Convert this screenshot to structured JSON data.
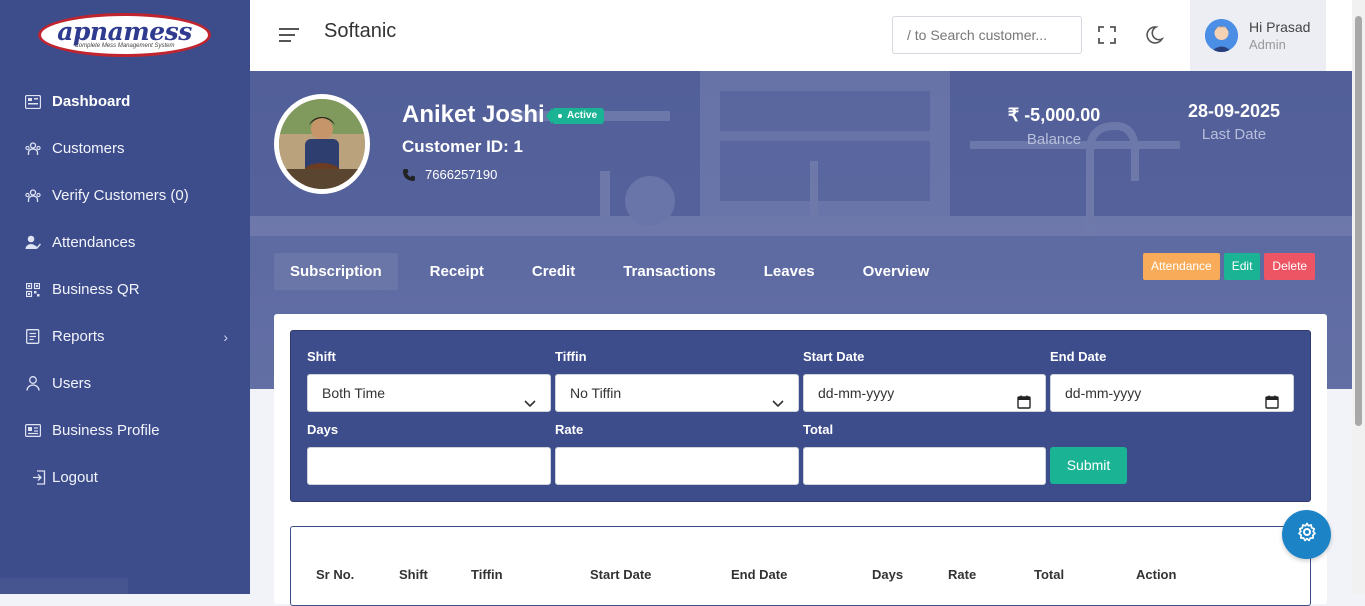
{
  "logo": {
    "title": "apnamess",
    "subtitle": "Complete Mess Management System"
  },
  "sidebar": {
    "items": [
      {
        "label": "Dashboard"
      },
      {
        "label": "Customers"
      },
      {
        "label": "Verify Customers (0)"
      },
      {
        "label": "Attendances"
      },
      {
        "label": "Business QR"
      },
      {
        "label": "Reports"
      },
      {
        "label": "Users"
      },
      {
        "label": "Business Profile"
      },
      {
        "label": "Logout"
      }
    ]
  },
  "header": {
    "brand": "Softanic",
    "search_placeholder": "/ to Search customer...",
    "user_greeting": "Hi Prasad",
    "user_role": "Admin"
  },
  "profile": {
    "name": "Aniket Joshi",
    "status": "Active",
    "customer_id": "Customer ID: 1",
    "phone": "7666257190",
    "balance_value": "₹ -5,000.00",
    "balance_label": "Balance",
    "last_date_value": "28-09-2025",
    "last_date_label": "Last Date"
  },
  "tabs": [
    "Subscription",
    "Receipt",
    "Credit",
    "Transactions",
    "Leaves",
    "Overview"
  ],
  "actions": {
    "attendance": "Attendance",
    "edit": "Edit",
    "delete": "Delete"
  },
  "form": {
    "shift_label": "Shift",
    "shift_value": "Both Time",
    "tiffin_label": "Tiffin",
    "tiffin_value": "No Tiffin",
    "start_date_label": "Start Date",
    "start_date_placeholder": "dd-mm-yyyy",
    "end_date_label": "End Date",
    "end_date_placeholder": "dd-mm-yyyy",
    "days_label": "Days",
    "rate_label": "Rate",
    "total_label": "Total",
    "submit_label": "Submit"
  },
  "table": {
    "headers": [
      "Sr No.",
      "Shift",
      "Tiffin",
      "Start Date",
      "End Date",
      "Days",
      "Rate",
      "Total",
      "Action"
    ]
  },
  "colors": {
    "sidebar": "#3d4d8c",
    "accent_green": "#1ab394",
    "warning": "#f8ac59",
    "danger": "#ed5565",
    "fab": "#1c84c6"
  }
}
